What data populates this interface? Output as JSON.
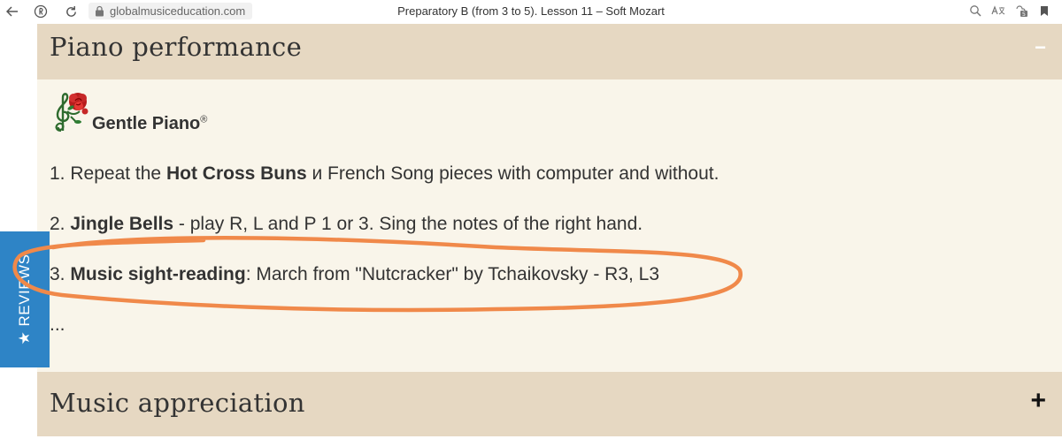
{
  "browser": {
    "url": "globalmusiceducation.com",
    "tab_title": "Preparatory B (from 3 to 5). Lesson 11 – Soft Mozart"
  },
  "section1": {
    "title": "Piano performance",
    "toggle": "−"
  },
  "brand": {
    "name": "Gentle Piano",
    "mark": "®"
  },
  "items": [
    {
      "num": "1.",
      "pre": "Repeat the ",
      "bold": "Hot Cross Buns",
      "post": " и French Song pieces with computer and without."
    },
    {
      "num": "2.",
      "pre": "",
      "bold": "Jingle Bells",
      "post": " - play R, L and P 1 or 3. Sing the notes of the right hand."
    },
    {
      "num": "3.",
      "pre": "",
      "bold": "Music sight-reading",
      "post": ": March from \"Nutcracker\" by Tchaikovsky - R3, L3"
    }
  ],
  "ellipsis": "...",
  "section2": {
    "title": "Music appreciation",
    "toggle": "+"
  },
  "reviews_tab": {
    "label": "★ REVIEWS"
  },
  "colors": {
    "accordion_header": "#e6d8c2",
    "panel_body": "#f9f5ea",
    "reviews_tab": "#2e84c6",
    "annotation": "#f0894a"
  }
}
